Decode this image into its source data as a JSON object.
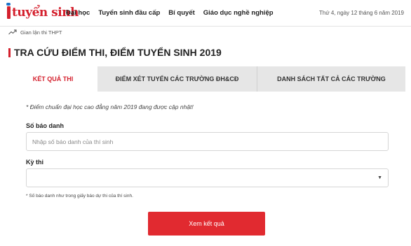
{
  "header": {
    "logo_text": "tuyensinh",
    "nav": [
      {
        "label": "Đại học"
      },
      {
        "label": "Tuyển sinh đầu cấp"
      },
      {
        "label": "Bí quyết"
      },
      {
        "label": "Giáo dục nghề nghiệp"
      }
    ],
    "date": "Thứ 4, ngày 12 tháng 6 năm 2019"
  },
  "trending": {
    "icon": "trending-up-icon",
    "text": "Gian lận thi THPT"
  },
  "page_title": "TRA CỨU ĐIỂM THI, ĐIỂM TUYỂN SINH 2019",
  "tabs": [
    {
      "label": "KẾT QUẢ THI",
      "active": true
    },
    {
      "label": "ĐIỂM XÉT TUYỂN CÁC TRƯỜNG ĐH&CĐ",
      "active": false
    },
    {
      "label": "DANH SÁCH TẤT CẢ CÁC TRƯỜNG",
      "active": false
    }
  ],
  "form": {
    "note": "* Điểm chuẩn đại học cao đẳng năm 2019 đang được cập nhật!",
    "sbd_label": "Số báo danh",
    "sbd_placeholder": "Nhập số báo danh của thí sinh",
    "sbd_value": "",
    "exam_label": "Kỳ thi",
    "exam_value": "",
    "hint": "* Số báo danh như trong giấy báo dự thi của thí sinh.",
    "submit_label": "Xem kết quả"
  },
  "colors": {
    "accent": "#d4202d",
    "button": "#e12a30",
    "tab_bg": "#e6e6e6"
  }
}
